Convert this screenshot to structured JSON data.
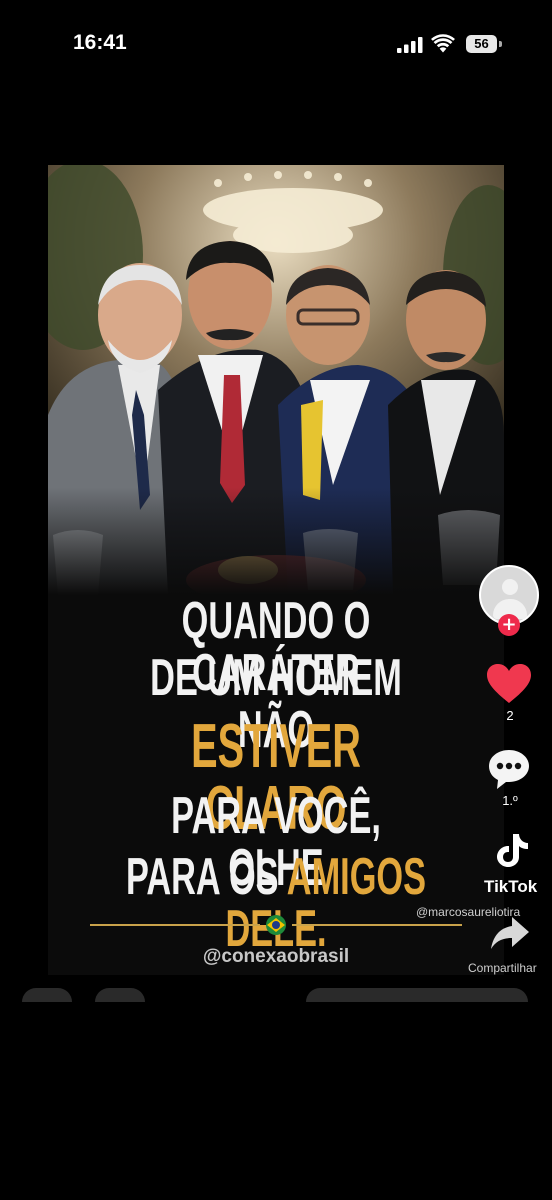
{
  "status_bar": {
    "time": "16:41",
    "battery": "56"
  },
  "video": {
    "quote_lines": [
      "QUANDO O CARÁTER",
      "DE UM HOMEM NÃO",
      "ESTIVER CLARO",
      "PARA VOCÊ, OLHE"
    ],
    "quote_last_prefix": "PARA OS ",
    "quote_last_highlight": "AMIGOS DELE.",
    "brand_handle": "@conexaobrasil",
    "highlight_color": "#e2a73c"
  },
  "side_rail": {
    "likes": "2",
    "comments": "1.º",
    "app_name": "TikTok",
    "watermark_user": "@marcosaureliotira",
    "share_label": "Compartilhar",
    "like_color": "#f0384f",
    "follow_color": "#ee2a4b"
  }
}
